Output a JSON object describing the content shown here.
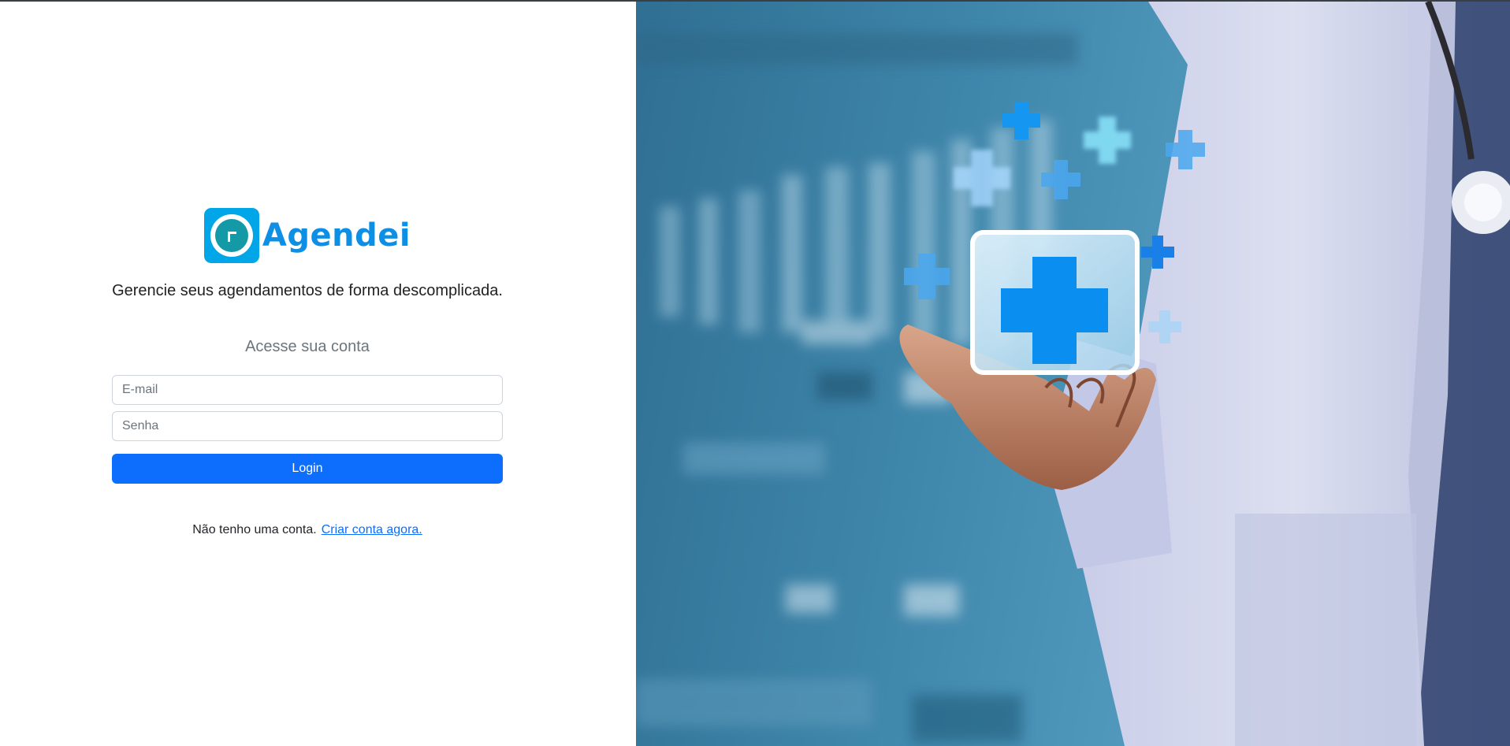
{
  "brand": {
    "name": "Agendei",
    "logo_icon": "agendei-logo-icon"
  },
  "tagline": "Gerencie seus agendamentos de forma descomplicada.",
  "form": {
    "title": "Acesse sua conta",
    "email_placeholder": "E-mail",
    "email_value": "",
    "password_placeholder": "Senha",
    "password_value": "",
    "login_label": "Login"
  },
  "signup": {
    "prompt": "Não tenho uma conta.",
    "link_label": "Criar conta agora."
  },
  "hero": {
    "description_icon": "doctor-holding-medical-cross-image"
  },
  "colors": {
    "brand": "#0e8fe6",
    "primary_button": "#0d6efd",
    "link": "#0d6efd",
    "hero_background": "#3f86ab"
  }
}
